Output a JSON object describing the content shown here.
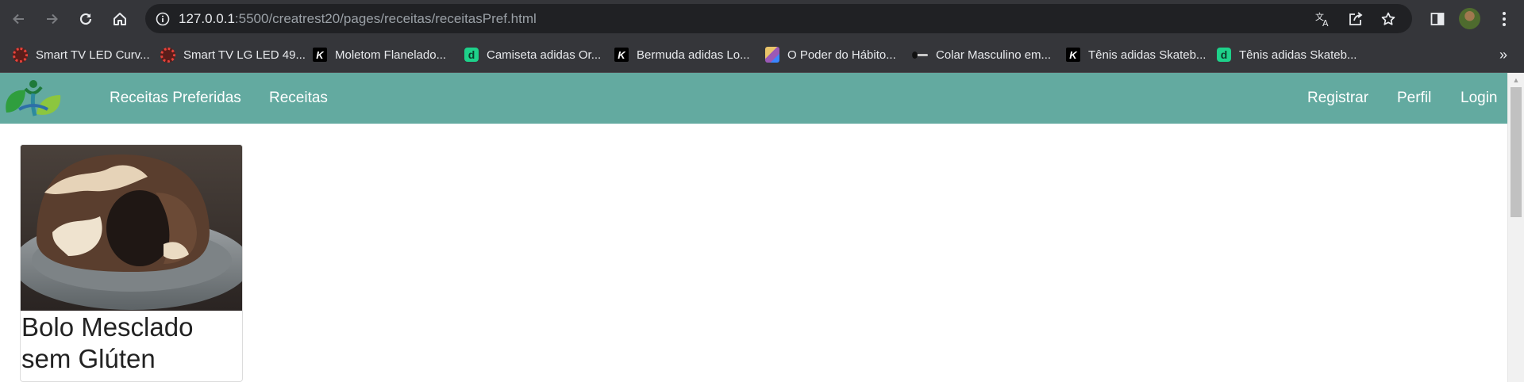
{
  "browser": {
    "url_host": "127.0.0.1",
    "url_rest": ":5500/creatrest20/pages/receitas/receitasPref.html",
    "icons": {
      "back": "back-arrow-icon",
      "forward": "forward-arrow-icon",
      "reload": "reload-icon",
      "home": "home-icon",
      "site_info": "info-icon",
      "translate": "translate-icon",
      "share": "share-icon",
      "bookmark": "star-icon",
      "side_panel": "side-panel-icon",
      "menu": "kebab-menu-icon"
    }
  },
  "bookmarks": [
    {
      "label": "Smart TV LED Curv...",
      "favicon": "red-circle"
    },
    {
      "label": "Smart TV LG LED 49...",
      "favicon": "red-circle"
    },
    {
      "label": "Moletom Flanelado...",
      "favicon": "k-logo"
    },
    {
      "label": "Camiseta adidas Or...",
      "favicon": "d-logo"
    },
    {
      "label": "Bermuda adidas Lo...",
      "favicon": "k-logo"
    },
    {
      "label": "O Poder do Hábito...",
      "favicon": "book"
    },
    {
      "label": "Colar Masculino em...",
      "favicon": "necklace"
    },
    {
      "label": "Tênis adidas Skateb...",
      "favicon": "k-logo"
    },
    {
      "label": "Tênis adidas Skateb...",
      "favicon": "d-logo"
    }
  ],
  "bookmarks_overflow": "»",
  "navbar": {
    "color": "#63aaa0",
    "left_links": [
      "Receitas Preferidas",
      "Receitas"
    ],
    "right_links": [
      "Registrar",
      "Perfil",
      "Login"
    ]
  },
  "cards": [
    {
      "title": "Bolo Mesclado sem Glúten",
      "image": "marble-cake-photo"
    }
  ]
}
